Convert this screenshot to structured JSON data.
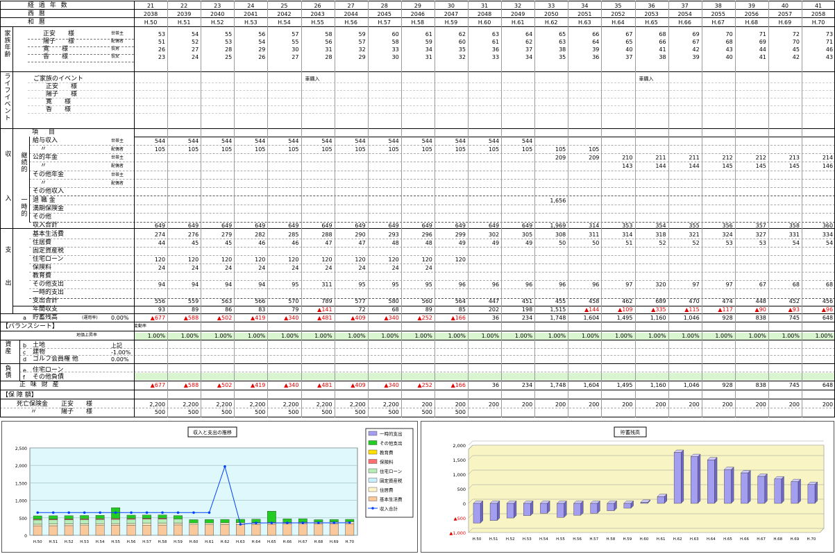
{
  "header": {
    "label_keika": "経 過 年 数",
    "label_seireki": "西 暦",
    "label_wareki": "和 暦",
    "years": [
      "21",
      "22",
      "23",
      "24",
      "25",
      "26",
      "27",
      "28",
      "29",
      "30",
      "31",
      "32",
      "33",
      "34",
      "35",
      "36",
      "37",
      "38",
      "39",
      "40",
      "41"
    ],
    "seireki": [
      "2038",
      "2039",
      "2040",
      "2041",
      "2042",
      "2043",
      "2044",
      "2045",
      "2046",
      "2047",
      "2048",
      "2049",
      "2050",
      "2051",
      "2052",
      "2053",
      "2054",
      "2055",
      "2056",
      "2057",
      "2058"
    ],
    "wareki": [
      "H.50",
      "H.51",
      "H.52",
      "H.53",
      "H.54",
      "H.55",
      "H.56",
      "H.57",
      "H.58",
      "H.59",
      "H.60",
      "H.61",
      "H.62",
      "H.63",
      "H.64",
      "H.65",
      "H.66",
      "H.67",
      "H.68",
      "H.69",
      "H.70"
    ]
  },
  "family": {
    "section": "家族年齢",
    "members": [
      {
        "name": "正安　　様",
        "role": "世帯主",
        "ages": [
          "53",
          "54",
          "55",
          "56",
          "57",
          "58",
          "59",
          "60",
          "61",
          "62",
          "63",
          "64",
          "65",
          "66",
          "67",
          "68",
          "69",
          "70",
          "71",
          "72",
          "73"
        ]
      },
      {
        "name": "陽子　　様",
        "role": "配偶者",
        "ages": [
          "51",
          "52",
          "53",
          "54",
          "55",
          "56",
          "57",
          "58",
          "59",
          "60",
          "61",
          "62",
          "63",
          "64",
          "65",
          "66",
          "67",
          "68",
          "69",
          "70",
          "71"
        ]
      },
      {
        "name": "寛　　様",
        "role": "長男",
        "ages": [
          "26",
          "27",
          "28",
          "29",
          "30",
          "31",
          "32",
          "33",
          "34",
          "35",
          "36",
          "37",
          "38",
          "39",
          "40",
          "41",
          "42",
          "43",
          "44",
          "45",
          "46"
        ]
      },
      {
        "name": "香　　様",
        "role": "長女",
        "ages": [
          "23",
          "24",
          "25",
          "26",
          "27",
          "28",
          "29",
          "30",
          "31",
          "32",
          "33",
          "34",
          "35",
          "36",
          "37",
          "38",
          "39",
          "40",
          "41",
          "42",
          "43"
        ]
      }
    ]
  },
  "life": {
    "section": "ライフイベント",
    "header": "ご家族のイベント",
    "rows": [
      "正安　　様",
      "陽子　　様",
      "寛　　様",
      "香　　様"
    ],
    "events": [
      "",
      "",
      "",
      "",
      "",
      "車購入",
      "",
      "",
      "",
      "",
      "",
      "",
      "",
      "",
      "",
      "車購入",
      "",
      "",
      "",
      "",
      ""
    ]
  },
  "income": {
    "section": "収入",
    "sub_keizoku": "継続的",
    "sub_ichiji": "一時的",
    "item_header": "項　目",
    "rows": [
      {
        "label": "給与収入",
        "role": "世帯主",
        "values": [
          "544",
          "544",
          "544",
          "544",
          "544",
          "544",
          "544",
          "544",
          "544",
          "544",
          "544",
          "544",
          "",
          "",
          "",
          "",
          "",
          "",
          "",
          "",
          ""
        ]
      },
      {
        "label": "〃",
        "role": "配偶者",
        "values": [
          "105",
          "105",
          "105",
          "105",
          "105",
          "105",
          "105",
          "105",
          "105",
          "105",
          "105",
          "105",
          "105",
          "105",
          "",
          "",
          "",
          "",
          "",
          "",
          ""
        ]
      },
      {
        "label": "公的年金",
        "role": "世帯主",
        "values": [
          "",
          "",
          "",
          "",
          "",
          "",
          "",
          "",
          "",
          "",
          "",
          "",
          "209",
          "209",
          "210",
          "211",
          "211",
          "212",
          "212",
          "213",
          "214"
        ]
      },
      {
        "label": "〃",
        "role": "配偶者",
        "values": [
          "",
          "",
          "",
          "",
          "",
          "",
          "",
          "",
          "",
          "",
          "",
          "",
          "",
          "",
          "143",
          "144",
          "144",
          "145",
          "145",
          "145",
          "146"
        ]
      },
      {
        "label": "その他年金",
        "role": "世帯主",
        "values": [
          "",
          "",
          "",
          "",
          "",
          "",
          "",
          "",
          "",
          "",
          "",
          "",
          "",
          "",
          "",
          "",
          "",
          "",
          "",
          "",
          ""
        ]
      },
      {
        "label": "〃",
        "role": "配偶者",
        "values": [
          "",
          "",
          "",
          "",
          "",
          "",
          "",
          "",
          "",
          "",
          "",
          "",
          "",
          "",
          "",
          "",
          "",
          "",
          "",
          "",
          ""
        ]
      },
      {
        "label": "その他収入",
        "role": "",
        "values": [
          "",
          "",
          "",
          "",
          "",
          "",
          "",
          "",
          "",
          "",
          "",
          "",
          "",
          "",
          "",
          "",
          "",
          "",
          "",
          "",
          ""
        ]
      },
      {
        "label": "退 職 金",
        "role": "",
        "values": [
          "",
          "",
          "",
          "",
          "",
          "",
          "",
          "",
          "",
          "",
          "",
          "",
          "1,656",
          "",
          "",
          "",
          "",
          "",
          "",
          "",
          ""
        ]
      },
      {
        "label": "満期保険金",
        "role": "",
        "values": [
          "",
          "",
          "",
          "",
          "",
          "",
          "",
          "",
          "",
          "",
          "",
          "",
          "",
          "",
          "",
          "",
          "",
          "",
          "",
          "",
          ""
        ]
      },
      {
        "label": "その他",
        "role": "",
        "values": [
          "",
          "",
          "",
          "",
          "",
          "",
          "",
          "",
          "",
          "",
          "",
          "",
          "",
          "",
          "",
          "",
          "",
          "",
          "",
          "",
          ""
        ]
      },
      {
        "label": "収入合計",
        "role": "",
        "values": [
          "649",
          "649",
          "649",
          "649",
          "649",
          "649",
          "649",
          "649",
          "649",
          "649",
          "649",
          "649",
          "1,969",
          "314",
          "353",
          "354",
          "355",
          "356",
          "357",
          "358",
          "360"
        ]
      }
    ]
  },
  "expense": {
    "section": "支出",
    "rows": [
      {
        "label": "基本生活費",
        "values": [
          "274",
          "276",
          "279",
          "282",
          "285",
          "288",
          "290",
          "293",
          "296",
          "299",
          "302",
          "305",
          "308",
          "311",
          "314",
          "318",
          "321",
          "324",
          "327",
          "331",
          "334"
        ]
      },
      {
        "label": "住居費",
        "values": [
          "44",
          "45",
          "45",
          "46",
          "46",
          "47",
          "47",
          "48",
          "48",
          "49",
          "49",
          "49",
          "50",
          "50",
          "51",
          "52",
          "52",
          "53",
          "53",
          "54",
          "54"
        ]
      },
      {
        "label": "固定資産税",
        "values": [
          "",
          "",
          "",
          "",
          "",
          "",
          "",
          "",
          "",
          "",
          "",
          "",
          "",
          "",
          "",
          "",
          "",
          "",
          "",
          "",
          ""
        ]
      },
      {
        "label": "住宅ローン",
        "values": [
          "120",
          "120",
          "120",
          "120",
          "120",
          "120",
          "120",
          "120",
          "120",
          "120",
          "",
          "",
          "",
          "",
          "",
          "",
          "",
          "",
          "",
          "",
          ""
        ]
      },
      {
        "label": "保険料",
        "values": [
          "24",
          "24",
          "24",
          "24",
          "24",
          "24",
          "24",
          "24",
          "24",
          "",
          "",
          "",
          "",
          "",
          "",
          "",
          "",
          "",
          "",
          "",
          ""
        ]
      },
      {
        "label": "教育費",
        "values": [
          "",
          "",
          "",
          "",
          "",
          "",
          "",
          "",
          "",
          "",
          "",
          "",
          "",
          "",
          "",
          "",
          "",
          "",
          "",
          "",
          ""
        ]
      },
      {
        "label": "その他支出",
        "values": [
          "94",
          "94",
          "94",
          "94",
          "95",
          "311",
          "95",
          "95",
          "95",
          "96",
          "96",
          "96",
          "96",
          "96",
          "97",
          "320",
          "97",
          "97",
          "67",
          "68",
          "68"
        ]
      },
      {
        "label": "一時的支出",
        "values": [
          "",
          "",
          "",
          "",
          "",
          "",
          "",
          "",
          "",
          "",
          "",
          "",
          "",
          "",
          "",
          "",
          "",
          "",
          "",
          "",
          ""
        ]
      },
      {
        "label": "支出合計",
        "values": [
          "556",
          "559",
          "563",
          "566",
          "570",
          "789",
          "577",
          "580",
          "560",
          "564",
          "447",
          "451",
          "455",
          "458",
          "462",
          "689",
          "470",
          "474",
          "448",
          "452",
          "456"
        ]
      }
    ]
  },
  "annual": {
    "label": "年間収支",
    "values": [
      "93",
      "89",
      "86",
      "83",
      "79",
      "▲141",
      "72",
      "68",
      "89",
      "85",
      "202",
      "198",
      "1,515",
      "▲144",
      "▲109",
      "▲335",
      "▲115",
      "▲117",
      "▲90",
      "▲93",
      "▲96"
    ]
  },
  "savings": {
    "prefix": "a",
    "label": "貯蓄残高",
    "sub": "(運用率)",
    "rate": "0.00%",
    "rate_header": "変動率",
    "values": [
      "▲677",
      "▲588",
      "▲502",
      "▲419",
      "▲340",
      "▲481",
      "▲409",
      "▲340",
      "▲252",
      "▲166",
      "36",
      "234",
      "1,748",
      "1,604",
      "1,495",
      "1,160",
      "1,046",
      "928",
      "838",
      "745",
      "648"
    ]
  },
  "balance": {
    "header": "【バランスシート】",
    "rate_header": "地価上昇率",
    "rate_row": "1.00%",
    "asset_section": "資産",
    "liab_section": "負債",
    "assets": [
      {
        "id": "b",
        "label": "土地",
        "note": "上記",
        "rate": ""
      },
      {
        "id": "c",
        "label": "建物",
        "note": "-1.00%",
        "rate": ""
      },
      {
        "id": "d",
        "label": "ゴルフ会員権 他",
        "note": "0.00%",
        "rate": ""
      }
    ],
    "liabilities": [
      {
        "id": "e",
        "label": "住宅ローン"
      },
      {
        "id": "f",
        "label": "その他負債"
      }
    ],
    "net_label": "正 味 財 産",
    "net_values": [
      "▲677",
      "▲588",
      "▲502",
      "▲419",
      "▲340",
      "▲481",
      "▲409",
      "▲340",
      "▲252",
      "▲166",
      "36",
      "234",
      "1,748",
      "1,604",
      "1,495",
      "1,160",
      "1,046",
      "928",
      "838",
      "745",
      "648"
    ]
  },
  "insurance": {
    "header": "【保 障 額】",
    "rows": [
      {
        "label": "死亡保険金",
        "name": "正安　　様",
        "values": [
          "2,200",
          "2,200",
          "2,200",
          "2,200",
          "2,200",
          "2,200",
          "2,200",
          "2,200",
          "200",
          "200",
          "200",
          "200",
          "200",
          "200",
          "200",
          "200",
          "200",
          "200",
          "200",
          "200",
          "200"
        ]
      },
      {
        "label": "〃",
        "name": "陽子　　様",
        "values": [
          "500",
          "500",
          "500",
          "500",
          "500",
          "500",
          "500",
          "500",
          "500",
          "500",
          "",
          "",
          "",
          "",
          "",
          "",
          "",
          "",
          "",
          "",
          ""
        ]
      }
    ]
  },
  "chart_data": [
    {
      "type": "bar",
      "title": "収入と支出の推移",
      "categories": [
        "H.50",
        "H.51",
        "H.52",
        "H.53",
        "H.54",
        "H.55",
        "H.56",
        "H.57",
        "H.58",
        "H.59",
        "H.60",
        "H.61",
        "H.62",
        "H.63",
        "H.64",
        "H.65",
        "H.66",
        "H.67",
        "H.68",
        "H.69",
        "H.70"
      ],
      "ylim": [
        0,
        2500
      ],
      "yticks": [
        "0",
        "500",
        "1,000",
        "1,500",
        "2,000",
        "2,500"
      ],
      "stacked": true,
      "series": [
        {
          "name": "基本生活費",
          "color": "#f9c89b",
          "values": [
            274,
            276,
            279,
            282,
            285,
            288,
            290,
            293,
            296,
            299,
            302,
            305,
            308,
            311,
            314,
            318,
            321,
            324,
            327,
            331,
            334
          ]
        },
        {
          "name": "住居費",
          "color": "#fff5c8",
          "values": [
            44,
            45,
            45,
            46,
            46,
            47,
            47,
            48,
            48,
            49,
            49,
            49,
            50,
            50,
            51,
            52,
            52,
            53,
            53,
            54,
            54
          ]
        },
        {
          "name": "固定資産税",
          "color": "#c8f0ff",
          "values": [
            0,
            0,
            0,
            0,
            0,
            0,
            0,
            0,
            0,
            0,
            0,
            0,
            0,
            0,
            0,
            0,
            0,
            0,
            0,
            0,
            0
          ]
        },
        {
          "name": "住宅ローン",
          "color": "#b8ecb8",
          "values": [
            120,
            120,
            120,
            120,
            120,
            120,
            120,
            120,
            120,
            120,
            0,
            0,
            0,
            0,
            0,
            0,
            0,
            0,
            0,
            0,
            0
          ]
        },
        {
          "name": "保険料",
          "color": "#ff6f6f",
          "values": [
            24,
            24,
            24,
            24,
            24,
            24,
            24,
            24,
            24,
            0,
            0,
            0,
            0,
            0,
            0,
            0,
            0,
            0,
            0,
            0,
            0
          ]
        },
        {
          "name": "教育費",
          "color": "#ffe000",
          "values": [
            0,
            0,
            0,
            0,
            0,
            0,
            0,
            0,
            0,
            0,
            0,
            0,
            0,
            0,
            0,
            0,
            0,
            0,
            0,
            0,
            0
          ]
        },
        {
          "name": "その他支出",
          "color": "#22cc22",
          "values": [
            94,
            94,
            94,
            94,
            95,
            311,
            95,
            95,
            95,
            96,
            96,
            96,
            96,
            96,
            97,
            320,
            97,
            97,
            67,
            68,
            68
          ]
        },
        {
          "name": "一時的支出",
          "color": "#a49ef0",
          "values": [
            0,
            0,
            0,
            0,
            0,
            0,
            0,
            0,
            0,
            0,
            0,
            0,
            0,
            0,
            0,
            0,
            0,
            0,
            0,
            0,
            0
          ]
        }
      ],
      "line": {
        "name": "収入合計",
        "color": "#0040ff",
        "values": [
          649,
          649,
          649,
          649,
          649,
          649,
          649,
          649,
          649,
          649,
          649,
          649,
          1969,
          314,
          353,
          354,
          355,
          356,
          357,
          358,
          360
        ]
      },
      "legend_order": [
        "一時的支出",
        "その他支出",
        "教育費",
        "保険料",
        "住宅ローン",
        "固定資産税",
        "住居費",
        "基本生活費",
        "収入合計"
      ],
      "plot_bg": "#dff8fb"
    },
    {
      "type": "bar",
      "title": "貯蓄残高",
      "categories": [
        "H.50",
        "H.51",
        "H.52",
        "H.53",
        "H.54",
        "H.55",
        "H.56",
        "H.57",
        "H.58",
        "H.59",
        "H.60",
        "H.61",
        "H.62",
        "H.63",
        "H.64",
        "H.65",
        "H.66",
        "H.67",
        "H.68",
        "H.69",
        "H.70"
      ],
      "values": [
        -677,
        -588,
        -502,
        -419,
        -340,
        -481,
        -409,
        -340,
        -252,
        -166,
        36,
        234,
        1748,
        1604,
        1495,
        1160,
        1046,
        928,
        838,
        745,
        648
      ],
      "ylim": [
        -1000,
        2000
      ],
      "yticks": [
        "▲1,000",
        "▲500",
        "0",
        "500",
        "1,000",
        "1,500",
        "2,000"
      ],
      "bar_color": "#a49ef0",
      "plot_bg": "#f8f4c4"
    }
  ]
}
